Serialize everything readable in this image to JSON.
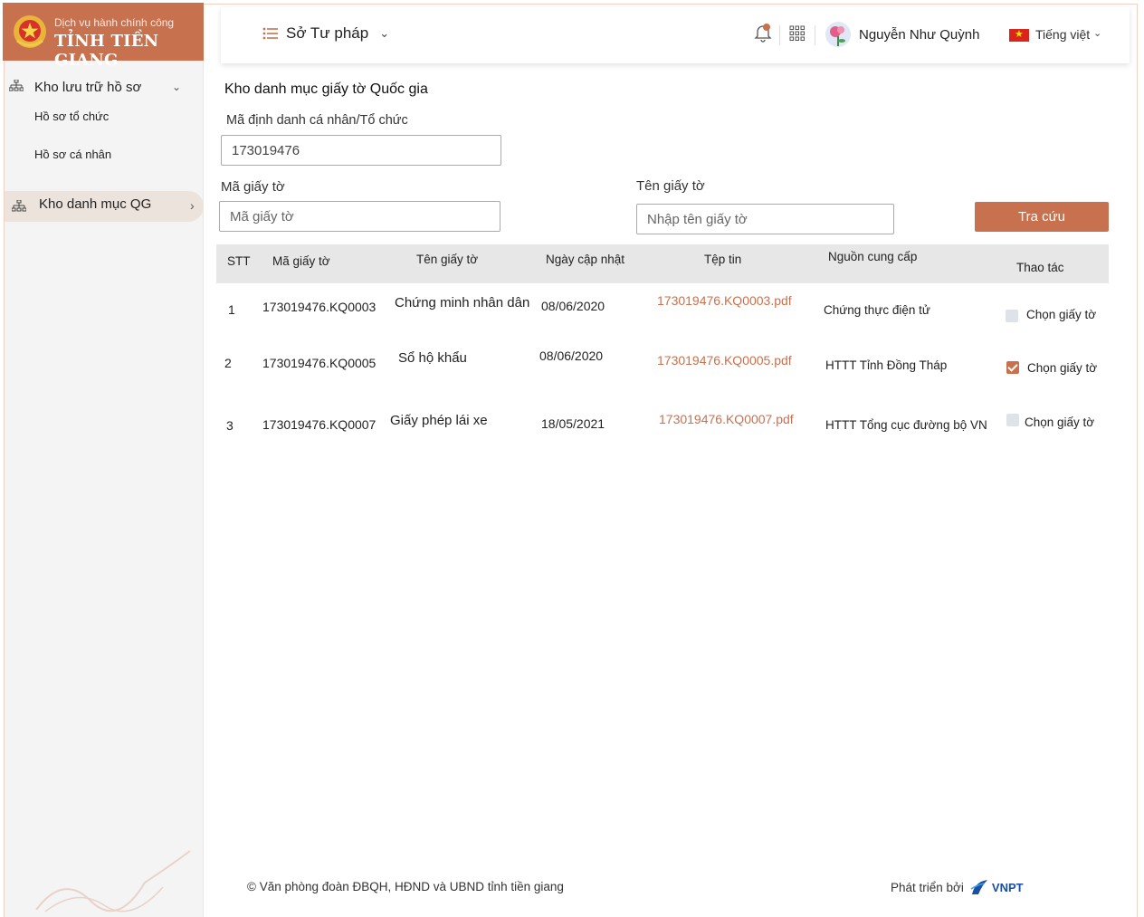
{
  "brand": {
    "subtitle": "Dịch vụ hành chính công",
    "title": "TỈNH TIỀN GIANG",
    "accent_color": "#c8714e"
  },
  "sidebar": {
    "groups": [
      {
        "label": "Kho lưu trữ hồ sơ",
        "icon": "sitemap-icon",
        "items": [
          {
            "label": "Hồ sơ tổ chức"
          },
          {
            "label": "Hồ sơ cá nhân"
          }
        ]
      },
      {
        "label": "Kho danh mục QG",
        "icon": "sitemap-icon",
        "active": true
      }
    ]
  },
  "header": {
    "department": "Sở Tư pháp",
    "user_name": "Nguyễn Như Quỳnh",
    "language": "Tiếng việt"
  },
  "page": {
    "title": "Kho danh mục giấy tờ Quốc gia",
    "id_label": "Mã định danh cá nhân/Tổ chức",
    "id_value": "173019476",
    "code_label": "Mã giấy tờ",
    "code_placeholder": "Mã giấy tờ",
    "name_label": "Tên giấy tờ",
    "name_placeholder": "Nhập tên giấy tờ",
    "search_button": "Tra cứu"
  },
  "table": {
    "headers": {
      "stt": "STT",
      "code": "Mã giấy tờ",
      "name": "Tên giấy tờ",
      "updated": "Ngày cập nhật",
      "file": "Tệp tin",
      "source": "Nguồn cung cấp",
      "action": "Thao tác"
    },
    "rows": [
      {
        "stt": "1",
        "code": "173019476.KQ0003",
        "name": "Chứng minh nhân dân",
        "updated": "08/06/2020",
        "file": "173019476.KQ0003.pdf",
        "source": "Chứng thực điện tử",
        "action": "Chọn giấy tờ",
        "checked": false
      },
      {
        "stt": "2",
        "code": "173019476.KQ0005",
        "name": "Sổ hộ khẩu",
        "updated": "08/06/2020",
        "file": "173019476.KQ0005.pdf",
        "source": "HTTT Tỉnh Đồng Tháp",
        "action": "Chọn giấy tờ",
        "checked": true
      },
      {
        "stt": "3",
        "code": "173019476.KQ0007",
        "name": "Giấy phép lái xe",
        "updated": "18/05/2021",
        "file": "173019476.KQ0007.pdf",
        "source": "HTTT Tổng cục đường bộ VN",
        "action": "Chọn giấy tờ",
        "checked": false
      }
    ]
  },
  "footer": {
    "copyright": "© Văn phòng đoàn ĐBQH, HĐND và UBND tỉnh tiền giang",
    "developed_by": "Phát triển bởi",
    "developer": "VNPT"
  }
}
